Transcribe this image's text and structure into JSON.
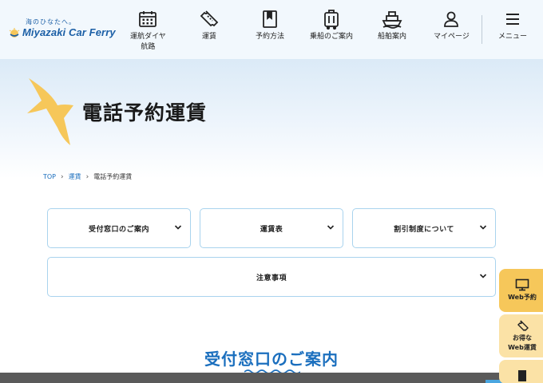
{
  "header": {
    "tagline": "海のひなたへ。",
    "brand": "Miyazaki Car Ferry",
    "nav": [
      {
        "label": "運航ダイヤ\n航路",
        "icon": "calendar-icon"
      },
      {
        "label": "運賃",
        "icon": "ticket-icon"
      },
      {
        "label": "予約方法",
        "icon": "bookmark-book-icon"
      },
      {
        "label": "乗船のご案内",
        "icon": "luggage-icon"
      },
      {
        "label": "船舶案内",
        "icon": "ship-icon"
      },
      {
        "label": "マイページ",
        "icon": "user-icon"
      },
      {
        "label": "メニュー",
        "icon": "hamburger-menu-icon"
      }
    ]
  },
  "hero": {
    "title": "電話予約運賃",
    "bird_color": "#f6c75a"
  },
  "breadcrumb": {
    "items": [
      "TOP",
      "運賃"
    ],
    "current": "電話予約運賃"
  },
  "accordions": [
    {
      "label": "受付窓口のご案内"
    },
    {
      "label": "運賃表"
    },
    {
      "label": "割引制度について"
    },
    {
      "label": "注意事項"
    }
  ],
  "section": {
    "title": "受付窓口のご案内"
  },
  "side_buttons": [
    {
      "label": "Web予約",
      "icon": "monitor-icon"
    },
    {
      "label": "お得な\nWeb運賃",
      "icon": "ticket-icon"
    },
    {
      "label": "",
      "icon": "book-icon"
    }
  ],
  "colors": {
    "brand_blue": "#1b5fa6",
    "accent_blue": "#1b6fbe",
    "border_blue": "#a9d3ee",
    "yellow": "#f6c75a",
    "light_yellow": "#fbe2a6"
  }
}
